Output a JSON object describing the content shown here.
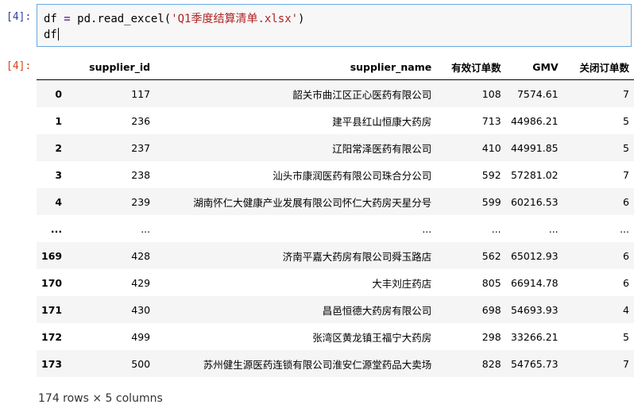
{
  "input_cell": {
    "prompt": "[4]:",
    "code_var": "df",
    "code_op": "=",
    "code_call": "pd.read_excel(",
    "code_str": "'Q1季度结算清单.xlsx'",
    "code_close": ")",
    "code_line2": "df"
  },
  "output_cell": {
    "prompt": "[4]:"
  },
  "dataframe": {
    "columns": [
      "",
      "supplier_id",
      "supplier_name",
      "有效订单数",
      "GMV",
      "关闭订单数"
    ],
    "rows": [
      [
        "0",
        "117",
        "韶关市曲江区正心医药有限公司",
        "108",
        "7574.61",
        "7"
      ],
      [
        "1",
        "236",
        "建平县红山恒康大药房",
        "713",
        "44986.21",
        "5"
      ],
      [
        "2",
        "237",
        "辽阳常泽医药有限公司",
        "410",
        "44991.85",
        "5"
      ],
      [
        "3",
        "238",
        "汕头市康润医药有限公司珠合分公司",
        "592",
        "57281.02",
        "7"
      ],
      [
        "4",
        "239",
        "湖南怀仁大健康产业发展有限公司怀仁大药房天星分号",
        "599",
        "60216.53",
        "6"
      ],
      [
        "...",
        "...",
        "...",
        "...",
        "...",
        "..."
      ],
      [
        "169",
        "428",
        "济南平嘉大药房有限公司舜玉路店",
        "562",
        "65012.93",
        "6"
      ],
      [
        "170",
        "429",
        "大丰刘庄药店",
        "805",
        "66914.78",
        "6"
      ],
      [
        "171",
        "430",
        "昌邑恒德大药房有限公司",
        "698",
        "54693.93",
        "4"
      ],
      [
        "172",
        "499",
        "张湾区黄龙镇王福宁大药房",
        "298",
        "33266.21",
        "5"
      ],
      [
        "173",
        "500",
        "苏州健生源医药连锁有限公司淮安仁源堂药品大卖场",
        "828",
        "54765.73",
        "7"
      ]
    ],
    "shape_text": "174 rows × 5 columns"
  }
}
